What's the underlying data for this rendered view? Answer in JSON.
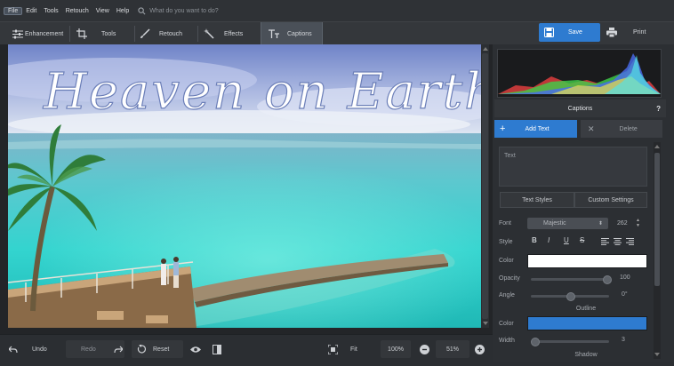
{
  "menu": {
    "items": [
      "File",
      "Edit",
      "Tools",
      "Retouch",
      "View",
      "Help"
    ],
    "search_placeholder": "What do you want to do?"
  },
  "toolbar": {
    "tabs": [
      {
        "label": "Enhancement",
        "icon": "sliders-icon"
      },
      {
        "label": "Tools",
        "icon": "crop-icon"
      },
      {
        "label": "Retouch",
        "icon": "brush-icon"
      },
      {
        "label": "Effects",
        "icon": "magic-wand-icon"
      },
      {
        "label": "Captions",
        "icon": "text-icon"
      }
    ],
    "save_label": "Save",
    "print_label": "Print"
  },
  "photo": {
    "caption_text": "Heaven on Earth"
  },
  "bottom": {
    "undo": "Undo",
    "redo": "Redo",
    "reset": "Reset",
    "fit": "Fit",
    "zoom_100": "100%",
    "zoom_value": "51%"
  },
  "panel": {
    "title": "Captions",
    "help": "?",
    "add_text": "Add Text",
    "delete": "Delete",
    "text_placeholder": "Text",
    "tab_text_styles": "Text Styles",
    "tab_custom_settings": "Custom Settings",
    "font_label": "Font",
    "font_value": "Majestic",
    "font_size": "262",
    "style_label": "Style",
    "style_buttons": [
      "B",
      "I",
      "U",
      "S"
    ],
    "color_label": "Color",
    "color_value": "#ffffff",
    "opacity_label": "Opacity",
    "opacity_value": "100",
    "angle_label": "Angle",
    "angle_value": "0°",
    "outline_label": "Outline",
    "outline_color_label": "Color",
    "outline_color_value": "#2e7bd0",
    "width_label": "Width",
    "width_value": "3",
    "shadow_label": "Shadow"
  },
  "colors": {
    "accent": "#2e7bd0",
    "background": "#2b2e32"
  }
}
